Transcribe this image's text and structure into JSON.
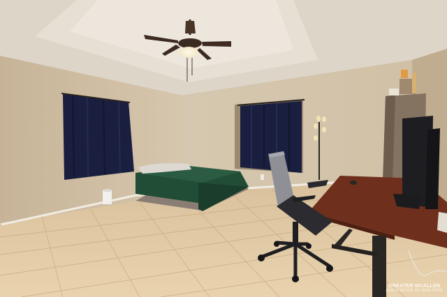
{
  "photo": {
    "subject": "bedroom-with-desk",
    "colors": {
      "wall": "#cfbfa6",
      "ceiling": "#e2dbcf",
      "floor_tile": "#e2c9a3",
      "bedspread": "#1f4a33",
      "curtains": "#1a1f3f",
      "desk": "#6e2f1d"
    }
  },
  "watermark": {
    "line1": "GREATER MCALLEN",
    "line2": "ASSOCIATION OF REALTORS"
  }
}
